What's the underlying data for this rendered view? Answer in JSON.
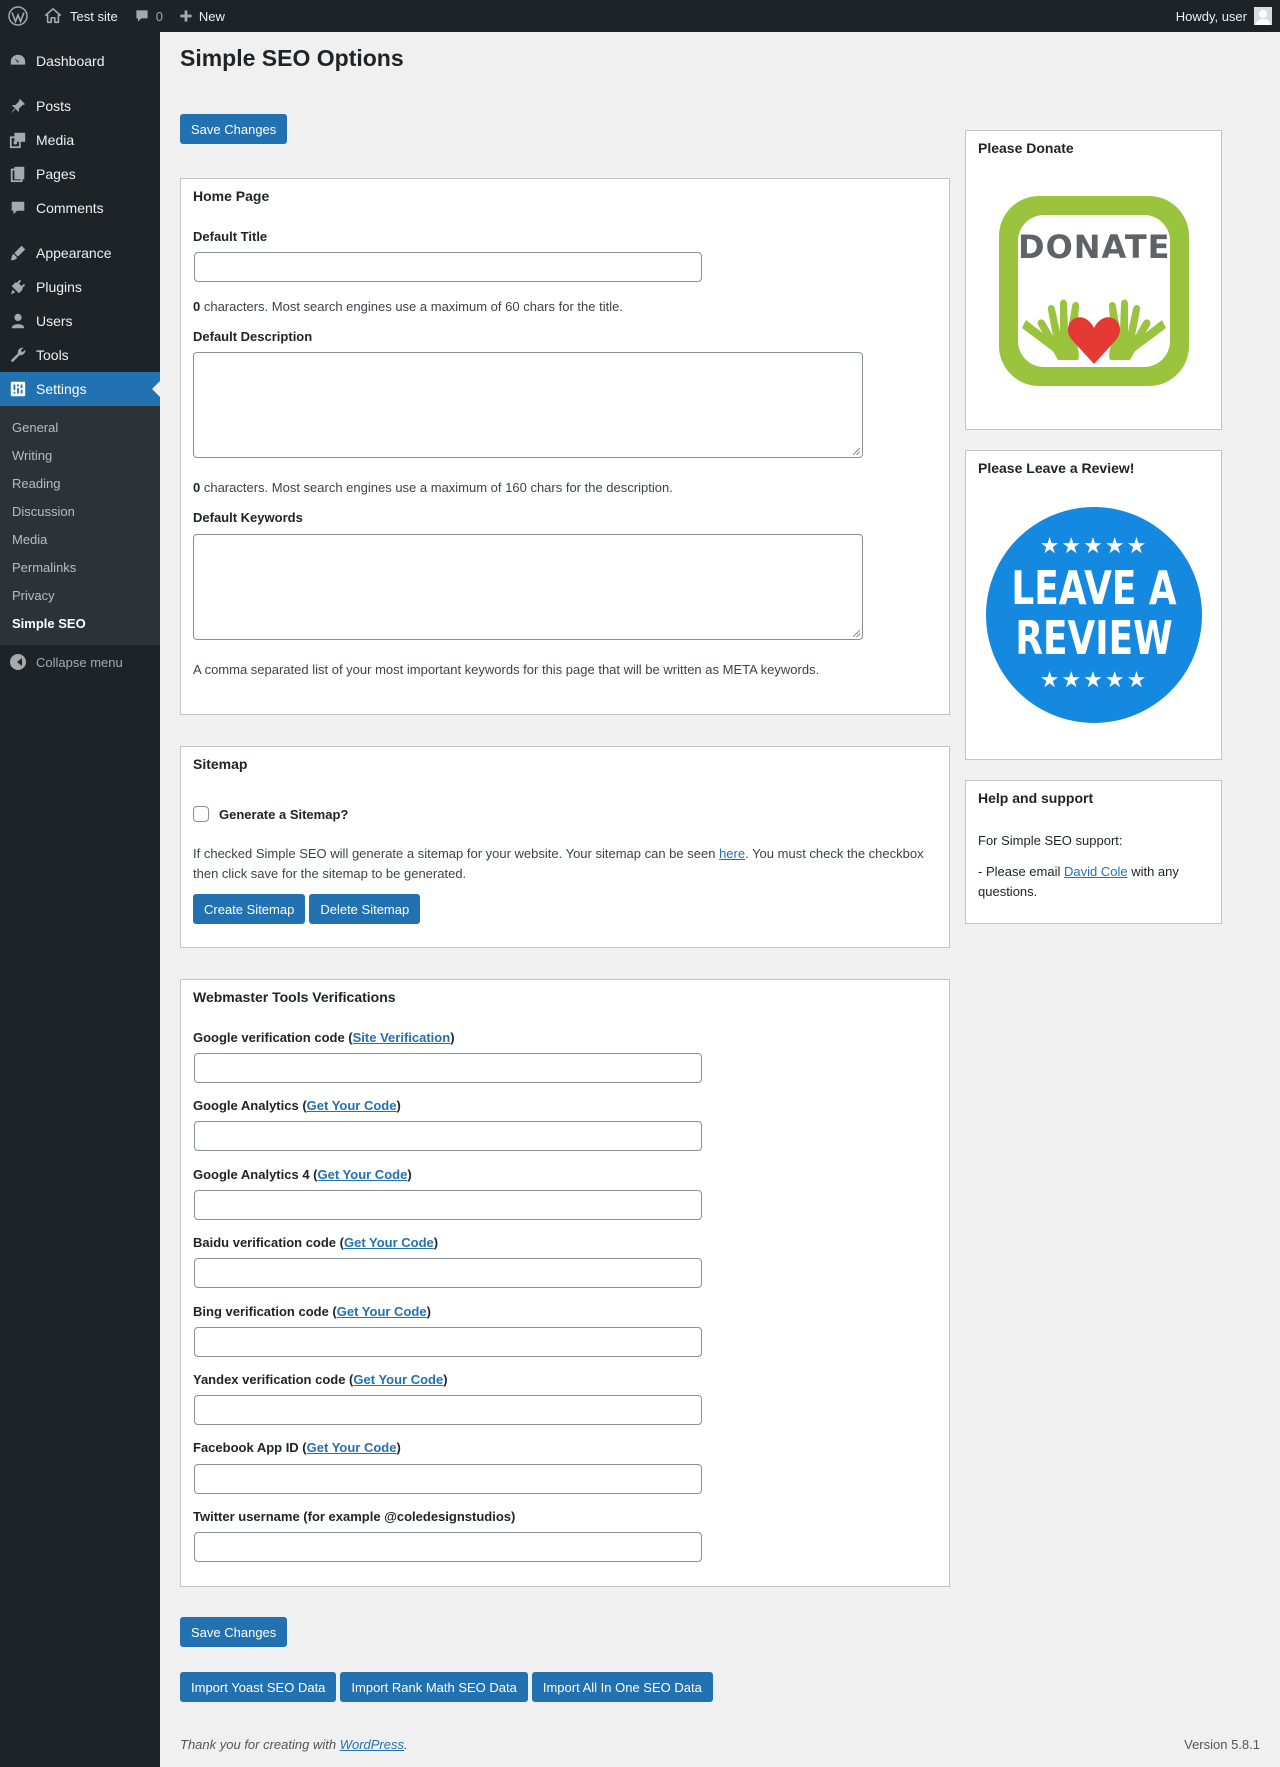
{
  "adminbar": {
    "site_name": "Test site",
    "comments_count": "0",
    "new_label": "New",
    "greeting": "Howdy, user"
  },
  "menu": {
    "items": [
      {
        "label": "Dashboard",
        "icon": "dashboard-icon"
      },
      {
        "label": "Posts",
        "icon": "pin-icon"
      },
      {
        "label": "Media",
        "icon": "media-icon"
      },
      {
        "label": "Pages",
        "icon": "pages-icon"
      },
      {
        "label": "Comments",
        "icon": "comment-icon"
      },
      {
        "label": "Appearance",
        "icon": "brush-icon"
      },
      {
        "label": "Plugins",
        "icon": "plug-icon"
      },
      {
        "label": "Users",
        "icon": "user-icon"
      },
      {
        "label": "Tools",
        "icon": "wrench-icon"
      },
      {
        "label": "Settings",
        "icon": "settings-icon"
      }
    ],
    "submenu": [
      "General",
      "Writing",
      "Reading",
      "Discussion",
      "Media",
      "Permalinks",
      "Privacy",
      "Simple SEO"
    ],
    "collapse_label": "Collapse menu"
  },
  "page": {
    "title": "Simple SEO Options",
    "save_label": "Save Changes"
  },
  "home": {
    "heading": "Home Page",
    "title_label": "Default Title",
    "title_count": "0",
    "title_help": " characters. Most search engines use a maximum of 60 chars for the title.",
    "desc_label": "Default Description",
    "desc_count": "0",
    "desc_help": " characters. Most search engines use a maximum of 160 chars for the description.",
    "keywords_label": "Default Keywords",
    "keywords_help": "A comma separated list of your most important keywords for this page that will be written as META keywords."
  },
  "sitemap": {
    "heading": "Sitemap",
    "checkbox_label": "Generate a Sitemap?",
    "help_before": "If checked Simple SEO will generate a sitemap for your website. Your sitemap can be seen ",
    "help_link": "here",
    "help_after": ". You must check the checkbox then click save for the sitemap to be generated.",
    "create_label": "Create Sitemap",
    "delete_label": "Delete Sitemap"
  },
  "webmaster": {
    "heading": "Webmaster Tools Verifications",
    "fields": [
      {
        "label": "Google verification code (",
        "link": "Site Verification",
        "after": ")"
      },
      {
        "label": "Google Analytics (",
        "link": "Get Your Code",
        "after": ")"
      },
      {
        "label": "Google Analytics 4 (",
        "link": "Get Your Code",
        "after": ")"
      },
      {
        "label": "Baidu verification code (",
        "link": "Get Your Code",
        "after": ")"
      },
      {
        "label": "Bing verification code (",
        "link": "Get Your Code",
        "after": ")"
      },
      {
        "label": "Yandex verification code (",
        "link": "Get Your Code",
        "after": ")"
      },
      {
        "label": "Facebook App ID (",
        "link": "Get Your Code",
        "after": ")"
      },
      {
        "label": "Twitter username (for example @coledesignstudios)",
        "link": "",
        "after": ""
      }
    ]
  },
  "imports": {
    "yoast": "Import Yoast SEO Data",
    "rankmath": "Import Rank Math SEO Data",
    "aioseo": "Import All In One SEO Data"
  },
  "sidebar": {
    "donate_heading": "Please Donate",
    "donate_logo_text": "DONATE",
    "review_heading": "Please Leave a Review!",
    "review_line1": "LEAVE A",
    "review_line2": "REVIEW",
    "help_heading": "Help and support",
    "help_intro": "For Simple SEO support:",
    "help_before": "- Please email ",
    "help_link": "David Cole",
    "help_after": " with any questions."
  },
  "footer": {
    "thanks_before": "Thank you for creating with ",
    "thanks_link": "WordPress",
    "thanks_after": ".",
    "version": "Version 5.8.1"
  },
  "colors": {
    "admin_dark": "#1d2327",
    "accent_blue": "#2271b1",
    "donate_green": "#9ac43e",
    "review_blue": "#1589e0",
    "heart_red": "#e53935"
  }
}
